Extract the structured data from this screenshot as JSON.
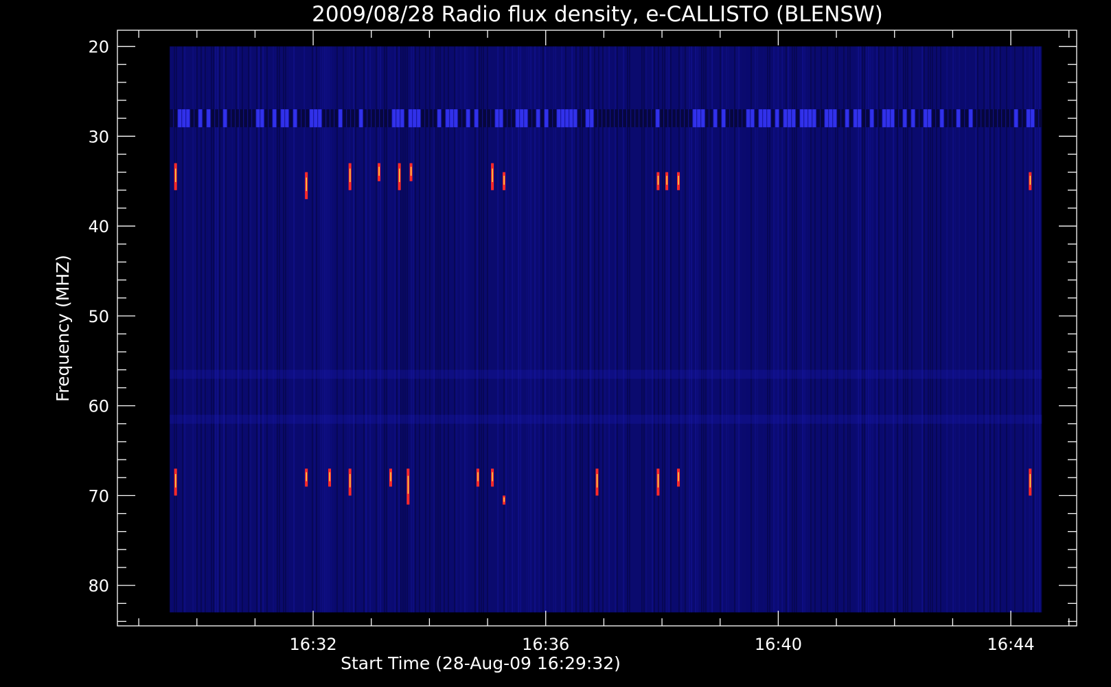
{
  "chart_data": {
    "type": "heatmap",
    "title": "2009/08/28  Radio flux density, e-CALLISTO (BLENSW)",
    "xlabel": "Start Time (28-Aug-09 16:29:32)",
    "ylabel": "Frequency (MHZ)",
    "x_axis": {
      "unit": "minutes after 16:29:32",
      "range": [
        -0.9,
        15.6
      ],
      "data_range": [
        0.0,
        15.0
      ],
      "ticks": [
        {
          "value": 2.467,
          "label": "16:32"
        },
        {
          "value": 6.467,
          "label": "16:36"
        },
        {
          "value": 10.467,
          "label": "16:40"
        },
        {
          "value": 14.467,
          "label": "16:44"
        }
      ]
    },
    "y_axis": {
      "range": [
        18.2,
        84.5
      ],
      "inverted": true,
      "data_range": [
        20,
        83
      ],
      "ticks": [
        {
          "value": 20,
          "label": "20"
        },
        {
          "value": 30,
          "label": "30"
        },
        {
          "value": 40,
          "label": "40"
        },
        {
          "value": 50,
          "label": "50"
        },
        {
          "value": 60,
          "label": "60"
        },
        {
          "value": 70,
          "label": "70"
        },
        {
          "value": 80,
          "label": "80"
        }
      ]
    },
    "colors": {
      "background": "#000000",
      "low": "#0a0a6e",
      "mid": "#1a1ab4",
      "high": "#ff2a2a",
      "peak": "#ffe04a"
    },
    "bands": [
      {
        "f_min": 27,
        "f_max": 29,
        "level": "elevated"
      },
      {
        "f_min": 56,
        "f_max": 57,
        "level": "slightly-elevated"
      },
      {
        "f_min": 61,
        "f_max": 62,
        "level": "slightly-elevated"
      }
    ],
    "bursts": [
      {
        "t": 0.1,
        "f_min": 33,
        "f_max": 36
      },
      {
        "t": 0.1,
        "f_min": 67,
        "f_max": 70
      },
      {
        "t": 2.35,
        "f_min": 34,
        "f_max": 37
      },
      {
        "t": 2.35,
        "f_min": 67,
        "f_max": 69
      },
      {
        "t": 2.75,
        "f_min": 67,
        "f_max": 69
      },
      {
        "t": 3.1,
        "f_min": 33,
        "f_max": 36
      },
      {
        "t": 3.1,
        "f_min": 67,
        "f_max": 70
      },
      {
        "t": 3.6,
        "f_min": 33,
        "f_max": 35
      },
      {
        "t": 3.95,
        "f_min": 33,
        "f_max": 36
      },
      {
        "t": 4.15,
        "f_min": 33,
        "f_max": 35
      },
      {
        "t": 4.1,
        "f_min": 67,
        "f_max": 71
      },
      {
        "t": 3.8,
        "f_min": 67,
        "f_max": 69
      },
      {
        "t": 5.3,
        "f_min": 67,
        "f_max": 69
      },
      {
        "t": 5.55,
        "f_min": 33,
        "f_max": 36
      },
      {
        "t": 5.55,
        "f_min": 67,
        "f_max": 69
      },
      {
        "t": 5.75,
        "f_min": 34,
        "f_max": 36
      },
      {
        "t": 5.75,
        "f_min": 70,
        "f_max": 71
      },
      {
        "t": 7.35,
        "f_min": 67,
        "f_max": 70
      },
      {
        "t": 8.4,
        "f_min": 34,
        "f_max": 36
      },
      {
        "t": 8.4,
        "f_min": 67,
        "f_max": 70
      },
      {
        "t": 8.55,
        "f_min": 34,
        "f_max": 36
      },
      {
        "t": 8.75,
        "f_min": 34,
        "f_max": 36
      },
      {
        "t": 8.75,
        "f_min": 67,
        "f_max": 69
      },
      {
        "t": 14.8,
        "f_min": 34,
        "f_max": 36
      },
      {
        "t": 14.8,
        "f_min": 67,
        "f_max": 70
      }
    ]
  }
}
